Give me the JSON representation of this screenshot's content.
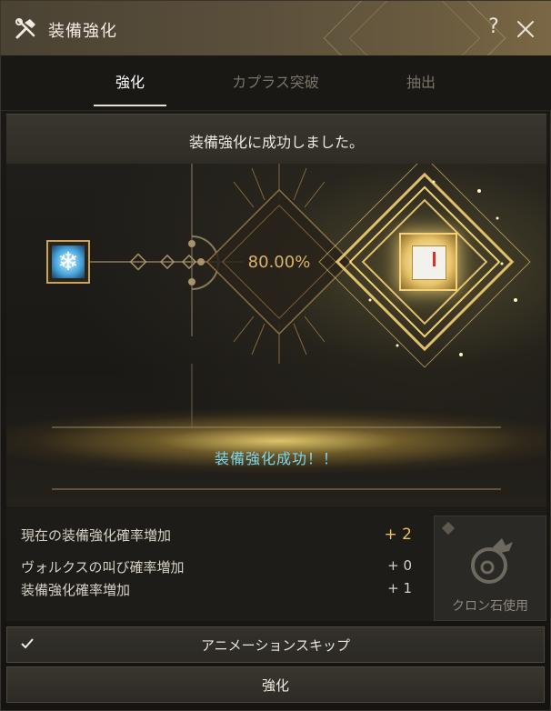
{
  "window": {
    "title": "装備強化"
  },
  "tabs": [
    {
      "label": "強化",
      "active": true
    },
    {
      "label": "カプラス突破",
      "active": false
    },
    {
      "label": "抽出",
      "active": false
    }
  ],
  "banner": {
    "message": "装備強化に成功しました。"
  },
  "enhance": {
    "rate": "80.00%",
    "result_text": "装備強化成功！！",
    "source_item_icon": "snowflake-icon",
    "result_item_icon": "enhanced-item-icon"
  },
  "stats": {
    "current_rate_label": "現在の装備強化確率増加",
    "current_rate_value": "+ 2",
    "valks_label": "ヴォルクスの叫び確率増加",
    "valks_value": "+ 0",
    "equip_label": "装備強化確率増加",
    "equip_value": "+ 1"
  },
  "cron": {
    "label": "クロン石使用",
    "icon": "cron-stone-icon"
  },
  "controls": {
    "skip_label": "アニメーションスキップ",
    "skip_checked": true,
    "enhance_button": "強化"
  },
  "colors": {
    "accent_gold": "#d8b46a",
    "success_cyan": "#7ad8f0",
    "bonus_orange": "#f0c060"
  }
}
